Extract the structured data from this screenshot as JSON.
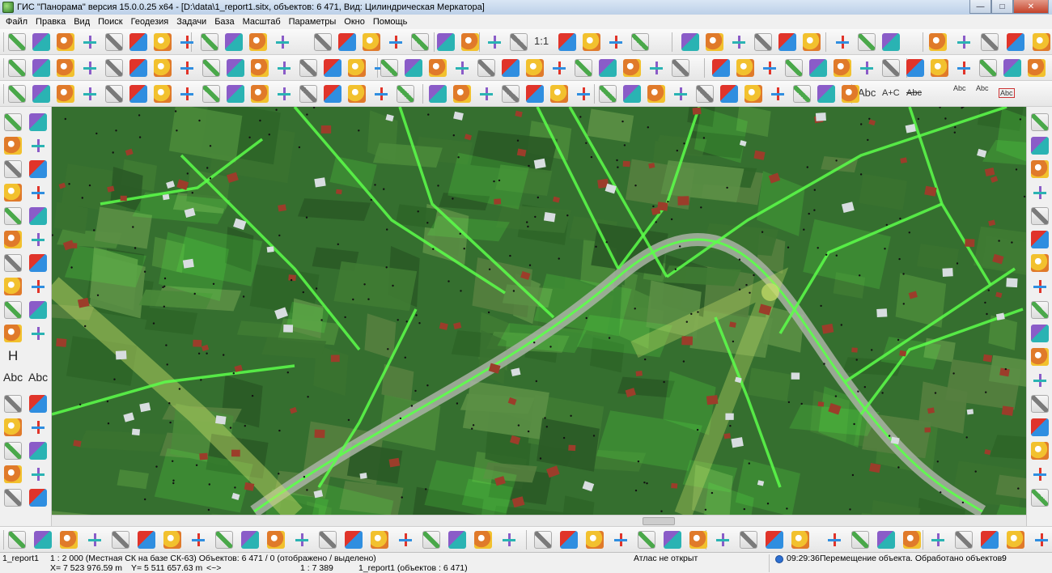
{
  "window": {
    "title": "ГИС \"Панорама\" версия 15.0.0.25 x64 - [D:\\data\\1_report1.sitx, объектов: 6 471, Вид: Цилиндрическая Меркатора]",
    "minimize": "—",
    "maximize": "□",
    "close": "✕"
  },
  "menu": [
    "Файл",
    "Правка",
    "Вид",
    "Поиск",
    "Геодезия",
    "Задачи",
    "База",
    "Масштаб",
    "Параметры",
    "Окно",
    "Помощь"
  ],
  "toolbar": {
    "scale_1to1": "1:1",
    "text_tool_abc": "Abc",
    "text_tool_abc_c": "A+C",
    "text_tool_abc_strike": "Abc",
    "text_tool_abc_small1": "Abc",
    "text_tool_abc_small2": "Abc",
    "text_tool_abc_box": "Abc"
  },
  "left_tools": {
    "text_h": "H",
    "text_abc1": "Abc",
    "text_abc2": "Abc"
  },
  "icon_palette": [
    "#e0342a",
    "#f2c12e",
    "#2f8ee0",
    "#4aa84a",
    "#8a5cc8",
    "#e07a2a",
    "#2ab3b3",
    "#7a7a7a"
  ],
  "map": {
    "background": "#356f2f",
    "overlay_color": "#5cff4a",
    "road_color": "#a9b3a4",
    "building_roof": "#9b3d2a"
  },
  "statusbar": {
    "map_name": "1_report1",
    "scale_info": "1 : 2 000 (Местная СК на базе СК-63) Объектов: 6 471 / 0 (отображено / выделено)",
    "atlas": "Атлас не открыт",
    "time": "09:29:36",
    "operation": "Перемещение объекта. Обработано объектов:",
    "processed_count": "9",
    "x_coord": "X= 7 523 976.59 m",
    "y_coord": "Y= 5 511 657.63 m",
    "arrows": "<~>",
    "view_scale": "1 : 7 389",
    "map_objects": "1_report1   (объектов : 6 471)"
  }
}
